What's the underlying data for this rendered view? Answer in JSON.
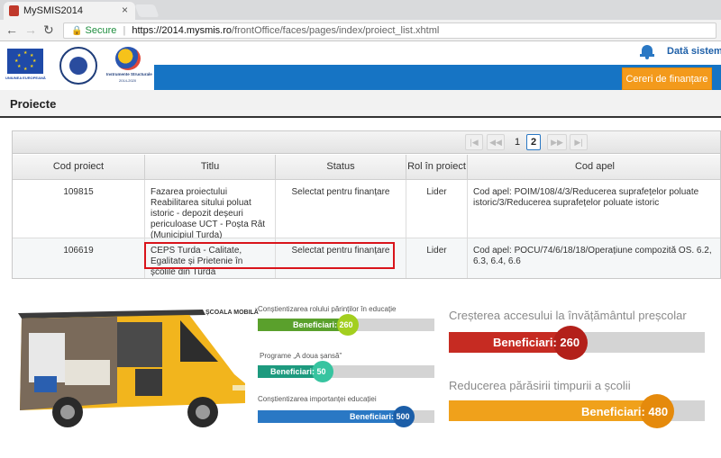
{
  "browser": {
    "tab_title": "MySMIS2014",
    "tab_close": "×",
    "secure_label": "Secure",
    "url_host": "https://2014.mysmis.ro",
    "url_path": "/frontOffice/faces/pages/index/proiect_list.xhtml"
  },
  "header": {
    "eu_logo_text": "UNIUNEA EUROPEANĂ",
    "is_logo_text": "Instrumente Structurale",
    "is_logo_years": "2014-2020",
    "system_data_label": "Dată sistem:",
    "cereri_button": "Cereri de finanțare"
  },
  "page": {
    "title": "Proiecte"
  },
  "paginator": {
    "first": "|◀",
    "prev": "◀◀",
    "pages": [
      "1",
      "2"
    ],
    "active_page": "2",
    "next": "▶▶",
    "last": "▶|"
  },
  "table": {
    "columns": [
      "Cod proiect",
      "Titlu",
      "Status",
      "Rol în proiect",
      "Cod apel"
    ],
    "rows": [
      {
        "cod": "109815",
        "titlu": "Fazarea proiectului Reabilitarea sitului poluat istoric - depozit deșeuri periculoase UCT - Poșta Rât (Municipiul Turda)",
        "status": "Selectat pentru finanțare",
        "rol": "Lider",
        "apel": "Cod apel: POIM/108/4/3/Reducerea suprafețelor poluate istoric/3/Reducerea suprafețelor poluate istoric"
      },
      {
        "cod": "106619",
        "titlu": "CEPS Turda - Calitate, Egalitate și Prietenie în școlile din Turda",
        "status": "Selectat pentru finanțare",
        "rol": "Lider",
        "apel": "Cod apel: POCU/74/6/18/18/Operațiune compozită OS. 6.2, 6.3, 6.4, 6.6"
      }
    ]
  },
  "infographic": {
    "vehicle_label": "ȘCOALA MOBILĂ",
    "indicators": [
      {
        "label": "Conștientizarea rolului părinților în educație",
        "value_text": "Beneficiari: 260",
        "value": 260,
        "color": "#5aa02c",
        "circle": "#a3cf1f"
      },
      {
        "label": "Programe „A doua șansă”",
        "value_text": "Beneficiari: 50",
        "value": 50,
        "color": "#1d9a7e",
        "circle": "#37c4a0"
      },
      {
        "label": "Conștientizarea importanței educației",
        "value_text": "Beneficiari: 500",
        "value": 500,
        "color": "#2a78c4",
        "circle": "#1c5ea8"
      },
      {
        "label": "Creșterea accesului la învățământul preșcolar",
        "value_text": "Beneficiari: 260",
        "value": 260,
        "color": "#c62b22",
        "circle": "#b3201a"
      },
      {
        "label": "Reducerea părăsirii timpurii a școlii",
        "value_text": "Beneficiari: 480",
        "value": 480,
        "color": "#f0a11b",
        "circle": "#e58a0c"
      }
    ]
  }
}
